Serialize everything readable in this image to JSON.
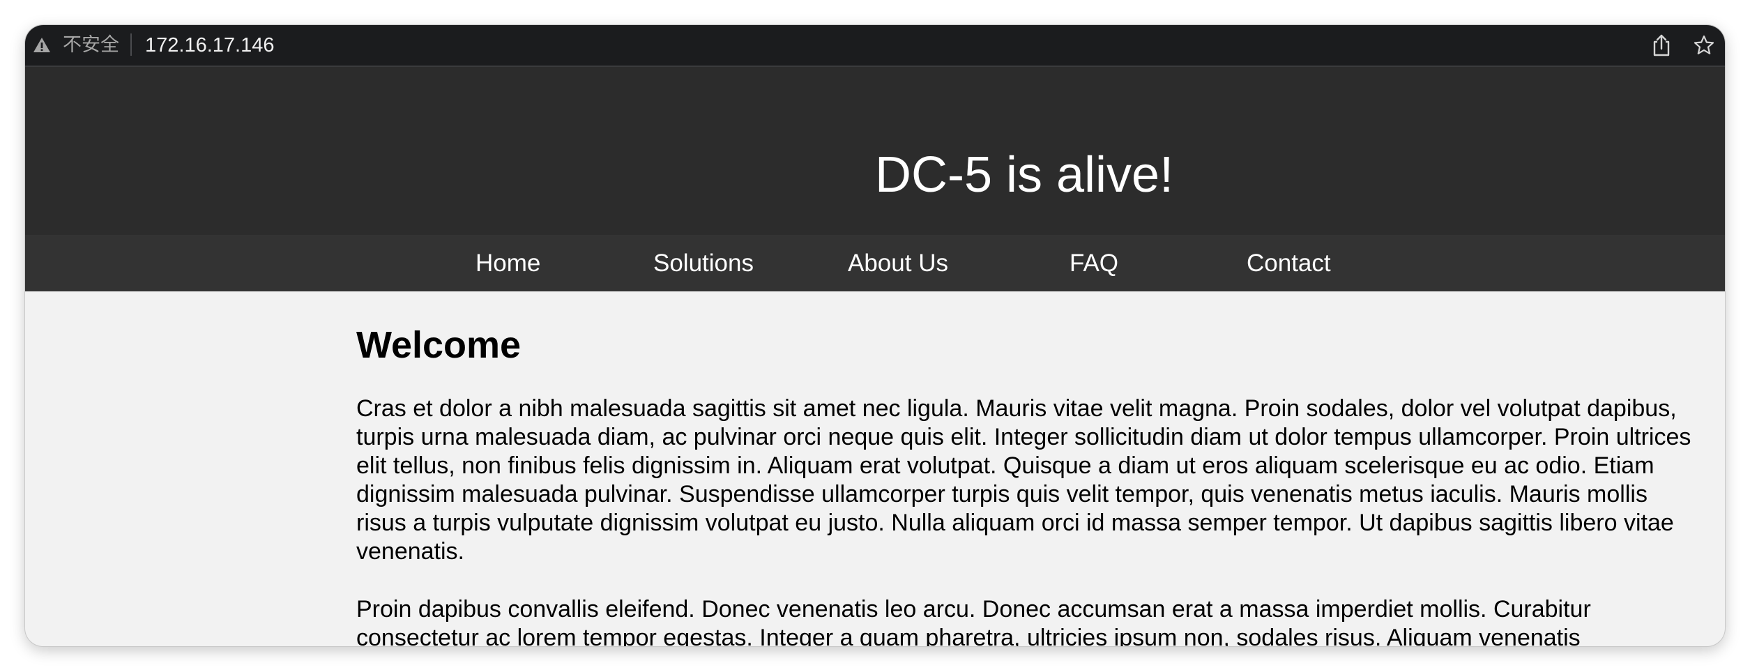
{
  "browser": {
    "security_label": "不安全",
    "url": "172.16.17.146",
    "icons": {
      "warning": "warning-icon",
      "share": "share-icon",
      "bookmark": "star-icon"
    }
  },
  "site": {
    "title": "DC-5 is alive!",
    "nav": [
      {
        "label": "Home"
      },
      {
        "label": "Solutions"
      },
      {
        "label": "About Us"
      },
      {
        "label": "FAQ"
      },
      {
        "label": "Contact"
      }
    ]
  },
  "main": {
    "heading": "Welcome",
    "paragraphs": [
      "Cras et dolor a nibh malesuada sagittis sit amet nec ligula. Mauris vitae velit magna. Proin sodales, dolor vel volutpat dapibus, turpis urna malesuada diam, ac pulvinar orci neque quis elit. Integer sollicitudin diam ut dolor tempus ullamcorper. Proin ultrices elit tellus, non finibus felis dignissim in. Aliquam erat volutpat. Quisque a diam ut eros aliquam scelerisque eu ac odio. Etiam dignissim malesuada pulvinar. Suspendisse ullamcorper turpis quis velit tempor, quis venenatis metus iaculis. Mauris mollis risus a turpis vulputate dignissim volutpat eu justo. Nulla aliquam orci id massa semper tempor. Ut dapibus sagittis libero vitae venenatis.",
      "Proin dapibus convallis eleifend. Donec venenatis leo arcu. Donec accumsan erat a massa imperdiet mollis. Curabitur consectetur ac lorem tempor egestas. Integer a quam pharetra, ultricies ipsum non, sodales risus. Aliquam venenatis"
    ]
  }
}
